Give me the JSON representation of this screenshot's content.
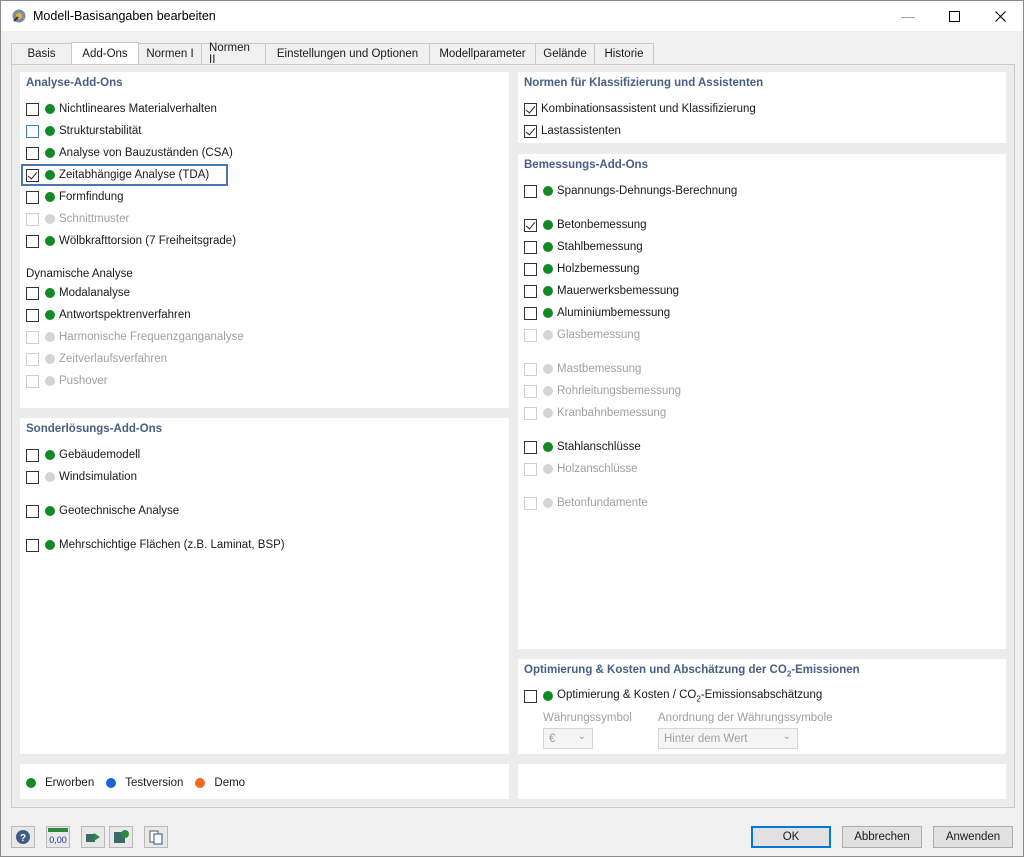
{
  "window": {
    "title": "Modell-Basisangaben bearbeiten",
    "min_icon": "minimize-icon",
    "max_icon": "maximize-icon",
    "close_icon": "close-icon"
  },
  "tabs": [
    {
      "label": "Basis",
      "active": false
    },
    {
      "label": "Add-Ons",
      "active": true
    },
    {
      "label": "Normen I",
      "active": false
    },
    {
      "label": "Normen II",
      "active": false
    },
    {
      "label": "Einstellungen und Optionen",
      "active": false
    },
    {
      "label": "Modellparameter",
      "active": false
    },
    {
      "label": "Gelände",
      "active": false
    },
    {
      "label": "Historie",
      "active": false
    }
  ],
  "analysis": {
    "title": "Analyse-Add-Ons",
    "items": [
      {
        "label": "Nichtlineares Materialverhalten",
        "checked": false,
        "status": "green",
        "enabled": true
      },
      {
        "label": "Strukturstabilität",
        "checked": false,
        "status": "green",
        "enabled": true
      },
      {
        "label": "Analyse von Bauzuständen (CSA)",
        "checked": false,
        "status": "green",
        "enabled": true
      },
      {
        "label": "Zeitabhängige Analyse (TDA)",
        "checked": true,
        "status": "green",
        "enabled": true
      },
      {
        "label": "Formfindung",
        "checked": false,
        "status": "green",
        "enabled": true
      },
      {
        "label": "Schnittmuster",
        "checked": false,
        "status": "gray",
        "enabled": false
      },
      {
        "label": "Wölbkrafttorsion (7 Freiheitsgrade)",
        "checked": false,
        "status": "green",
        "enabled": true
      }
    ],
    "dynamic_title": "Dynamische Analyse",
    "dynamic_items": [
      {
        "label": "Modalanalyse",
        "checked": false,
        "status": "green",
        "enabled": true
      },
      {
        "label": "Antwortspektrenverfahren",
        "checked": false,
        "status": "green",
        "enabled": true
      },
      {
        "label": "Harmonische Frequenzganganalyse",
        "checked": false,
        "status": "gray",
        "enabled": false
      },
      {
        "label": "Zeitverlaufsverfahren",
        "checked": false,
        "status": "gray",
        "enabled": false
      },
      {
        "label": "Pushover",
        "checked": false,
        "status": "gray",
        "enabled": false
      }
    ]
  },
  "special": {
    "title": "Sonderlösungs-Add-Ons",
    "items": [
      {
        "label": "Gebäudemodell",
        "checked": false,
        "status": "green",
        "enabled": true
      },
      {
        "label": "Windsimulation",
        "checked": false,
        "status": "gray",
        "enabled": true
      },
      {
        "label": "Geotechnische Analyse",
        "checked": false,
        "status": "green",
        "enabled": true
      },
      {
        "label": "Mehrschichtige Flächen (z.B. Laminat, BSP)",
        "checked": false,
        "status": "green",
        "enabled": true
      }
    ]
  },
  "norms": {
    "title": "Normen für Klassifizierung und Assistenten",
    "items": [
      {
        "label": "Kombinationsassistent und Klassifizierung",
        "checked": true
      },
      {
        "label": "Lastassistenten",
        "checked": true
      }
    ]
  },
  "design": {
    "title": "Bemessungs-Add-Ons",
    "items": [
      {
        "label": "Spannungs-Dehnungs-Berechnung",
        "checked": false,
        "status": "green",
        "enabled": true
      },
      {
        "label": "Betonbemessung",
        "checked": true,
        "status": "green",
        "enabled": true
      },
      {
        "label": "Stahlbemessung",
        "checked": false,
        "status": "green",
        "enabled": true
      },
      {
        "label": "Holzbemessung",
        "checked": false,
        "status": "green",
        "enabled": true
      },
      {
        "label": "Mauerwerksbemessung",
        "checked": false,
        "status": "green",
        "enabled": true
      },
      {
        "label": "Aluminiumbemessung",
        "checked": false,
        "status": "green",
        "enabled": true
      },
      {
        "label": "Glasbemessung",
        "checked": false,
        "status": "gray",
        "enabled": false
      },
      {
        "label": "Mastbemessung",
        "checked": false,
        "status": "gray",
        "enabled": false
      },
      {
        "label": "Rohrleitungsbemessung",
        "checked": false,
        "status": "gray",
        "enabled": false
      },
      {
        "label": "Kranbahnbemessung",
        "checked": false,
        "status": "gray",
        "enabled": false
      },
      {
        "label": "Stahlanschlüsse",
        "checked": false,
        "status": "green",
        "enabled": true
      },
      {
        "label": "Holzanschlüsse",
        "checked": false,
        "status": "gray",
        "enabled": false
      },
      {
        "label": "Betonfundamente",
        "checked": false,
        "status": "gray",
        "enabled": false
      }
    ]
  },
  "optimization": {
    "title_pre": "Optimierung & Kosten und Abschätzung der CO",
    "title_sub": "2",
    "title_post": "-Emissionen",
    "item_pre": "Optimierung & Kosten / CO",
    "item_sub": "2",
    "item_post": "-Emissionsabschätzung",
    "checked": false,
    "status": "green",
    "currency_label": "Währungssymbol",
    "currency_value": "€",
    "arrangement_label": "Anordnung der Währungssymbole",
    "arrangement_value": "Hinter dem Wert"
  },
  "legend": [
    {
      "label": "Erworben",
      "color": "#0f8b25"
    },
    {
      "label": "Testversion",
      "color": "#1565d8"
    },
    {
      "label": "Demo",
      "color": "#f06b1c"
    }
  ],
  "toolbar": {
    "icons": [
      "help-icon",
      "units-icon",
      "model-transfer-icon",
      "model-settings-icon",
      "clipboard-icon"
    ],
    "units_text": "0,00"
  },
  "buttons": {
    "ok": "OK",
    "cancel": "Abbrechen",
    "apply": "Anwenden"
  }
}
